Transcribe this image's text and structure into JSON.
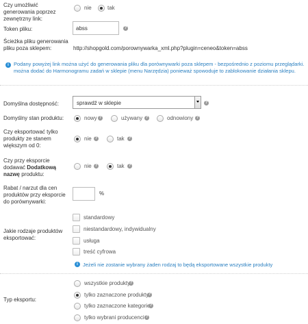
{
  "export_link": {
    "label": "Czy umożliwić generowania poprzez zewnętrzny link:",
    "options": [
      "nie",
      "tak"
    ]
  },
  "token": {
    "label": "Token pliku:",
    "value": "abss"
  },
  "path": {
    "label": "Ścieżka pliku generowania pliku poza sklepem:",
    "url": "http://shopgold.com/porownywarka_xml.php?plugin=ceneo&token=abss"
  },
  "note_link": "Podany powyżej link można użyć do generowania pliku dla porównywarki poza sklepem - bezpośrednio z poziomu przeglądarki. można dodać do Harmonogramu zadań w sklepie (menu Narzędzia) ponieważ spowoduje to zablokowanie działania sklepu.",
  "availability": {
    "label": "Domyślna dostępność:",
    "value": "sprawdź w sklepie"
  },
  "condition": {
    "label": "Domyślny stan produktu:",
    "options": [
      "nowy",
      "używany",
      "odnowiony"
    ]
  },
  "zero_stock": {
    "label": "Czy eksportować tylko produkty ze stanem większym od 0:",
    "options": [
      "nie",
      "tak"
    ]
  },
  "extra_name": {
    "label_pre": "Czy przy eksporcie dodawać ",
    "label_bold": "Dodatkową nazwę",
    "label_post": " produktu:",
    "options": [
      "nie",
      "tak"
    ]
  },
  "discount": {
    "label": "Rabat / narzut dla cen produktów przy eksporcie do porównywarki:",
    "unit": "%",
    "value": ""
  },
  "product_types": {
    "label": "Jakie rodzaje produktów eksportować:",
    "items": [
      "standardowy",
      "niestandardowy, indywidualny",
      "usługa",
      "treść cyfrowa"
    ],
    "note": "Jeżeli nie zostanie wybrany żaden rodzaj to będą eksportowane wszystkie produkty"
  },
  "export_type": {
    "label": "Typ eksportu:",
    "options": [
      "wszystkie produkty",
      "tylko zaznaczone produkty",
      "tylko zaznaczone kategorie",
      "tylko wybrani producenci"
    ]
  },
  "icons": {
    "help": "?",
    "info": "i"
  },
  "colors": {
    "info": "#2a8fd6",
    "note_text": "#2a7fc0"
  }
}
